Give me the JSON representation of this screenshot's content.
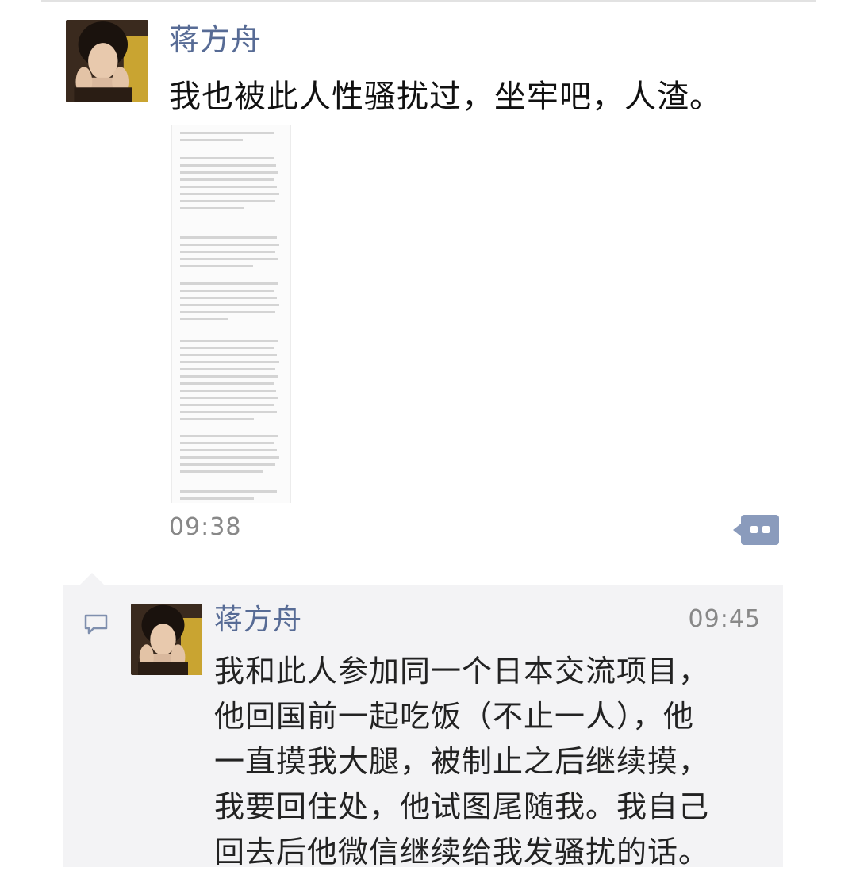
{
  "post": {
    "author": "蒋方舟",
    "text": "我也被此人性骚扰过，坐牢吧，人渣。",
    "time": "09:38",
    "more_icon": "more-dots-icon",
    "avatar_icon": "user-avatar"
  },
  "comments": {
    "icon": "comment-bubble-icon",
    "items": [
      {
        "author": "蒋方舟",
        "time": "09:45",
        "lines": [
          "我和此人参加同一个日本交流项目，",
          "他回国前一起吃饭（不止一人），他",
          "一直摸我大腿，被制止之后继续摸，",
          "我要回住处，他试图尾随我。我自己",
          "回去后他微信继续给我发骚扰的话。"
        ]
      }
    ]
  },
  "colors": {
    "author_name": "#576b95",
    "time": "#888888",
    "comment_background": "#f3f3f5",
    "more_button": "#8a9bbc"
  }
}
